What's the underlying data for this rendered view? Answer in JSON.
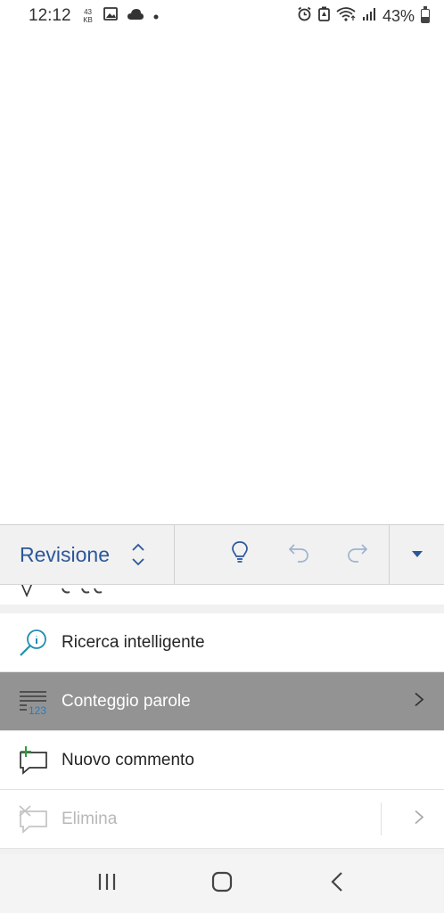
{
  "status_bar": {
    "time": "12:12",
    "kb_top": "43",
    "kb_bottom": "KB",
    "battery_percent": "43%",
    "battery_level": 0.43
  },
  "ribbon": {
    "tab_label": "Revisione"
  },
  "menu": {
    "items": [
      {
        "label": "Ricerca intelligente",
        "icon": "smart-lookup-icon"
      },
      {
        "label": "Conteggio parole",
        "icon": "word-count-icon",
        "selected": true,
        "has_submenu": true
      },
      {
        "label": "Nuovo commento",
        "icon": "new-comment-icon"
      },
      {
        "label": "Elimina",
        "icon": "delete-comment-icon",
        "disabled": true,
        "has_submenu": true
      }
    ]
  },
  "colors": {
    "accent": "#2b579a",
    "selected_row": "#939393",
    "comment_plus": "#2e9b3e",
    "smart_lookup": "#1f8fb0"
  }
}
